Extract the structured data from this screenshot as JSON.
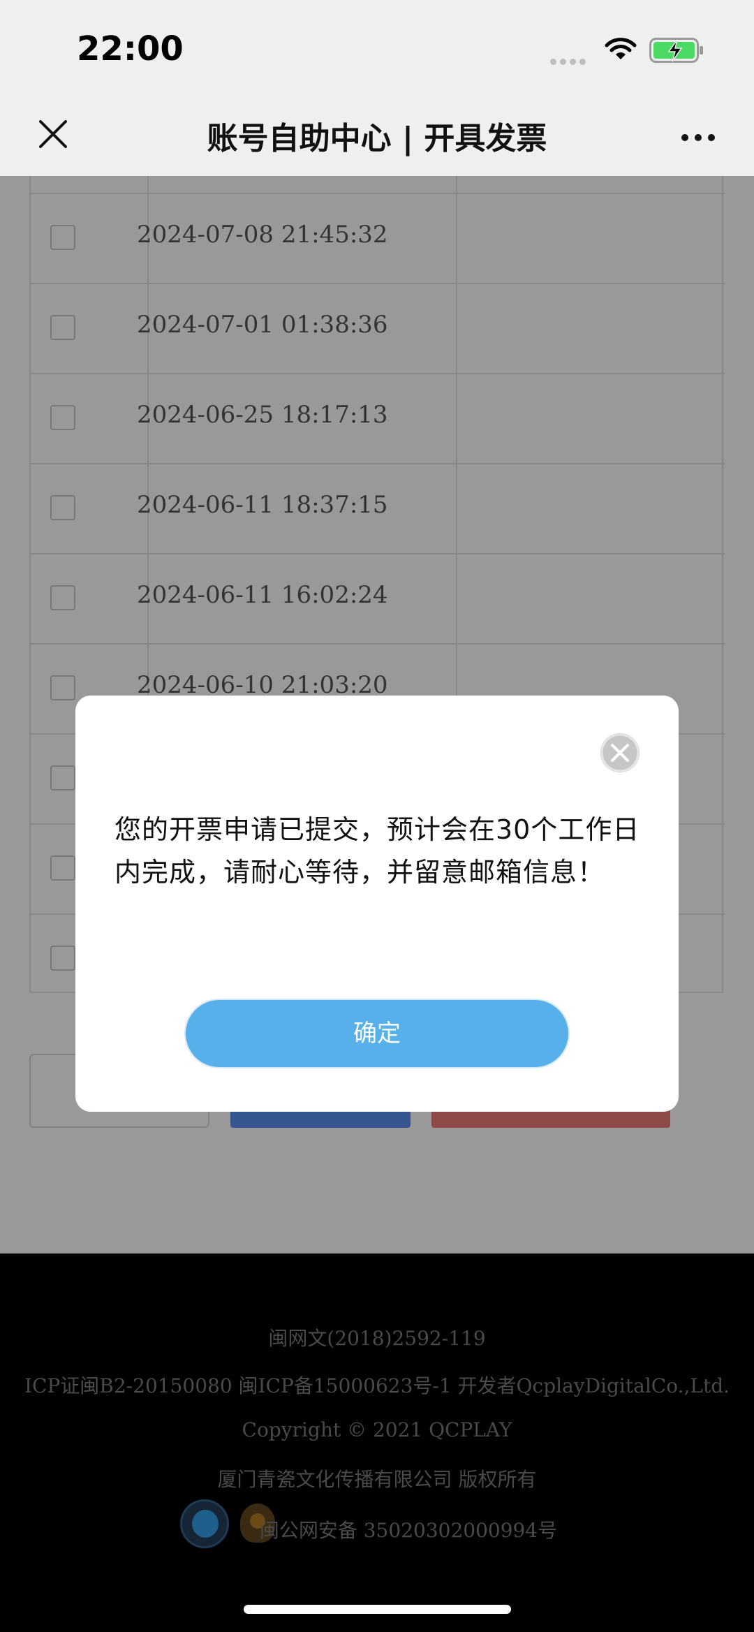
{
  "status_bar": {
    "time": "22:00",
    "signal_icon": "signal-dots-icon",
    "wifi_icon": "wifi-icon",
    "battery_icon": "battery-charging-icon",
    "battery_color": "#4cd964"
  },
  "nav": {
    "title": "账号自助中心 | 开具发票",
    "close_icon": "close-icon",
    "more_icon": "more-dots-icon"
  },
  "table": {
    "rows": [
      {
        "date": "2024-07-08 21:45:32"
      },
      {
        "date": "2024-07-01 01:38:36"
      },
      {
        "date": "2024-06-25 18:17:13"
      },
      {
        "date": "2024-06-11 18:37:15"
      },
      {
        "date": "2024-06-11 16:02:24"
      },
      {
        "date": "2024-06-10 21:03:20"
      },
      {
        "date": ""
      },
      {
        "date": ""
      },
      {
        "date": ""
      }
    ]
  },
  "buttons": {
    "outline_partial": "",
    "blue_color": "#5b8ff2",
    "red_color": "#f07b7b"
  },
  "modal": {
    "message": "您的开票申请已提交，预计会在30个工作日内完成，请耐心等待，并留意邮箱信息！",
    "confirm_label": "确定",
    "close_icon": "close-circle-icon",
    "button_color": "#57b0ea"
  },
  "footer": {
    "line1": "闽网文(2018)2592-119",
    "line2": "ICP证闽B2-20150080 闽ICP备15000623号-1 开发者QcplayDigitalCo.,Ltd.",
    "line3": "Copyright  © 2021  QCPLAY",
    "line4": "厦门青瓷文化传播有限公司  版权所有",
    "line5": "闽公网安备 35020302000994号"
  }
}
